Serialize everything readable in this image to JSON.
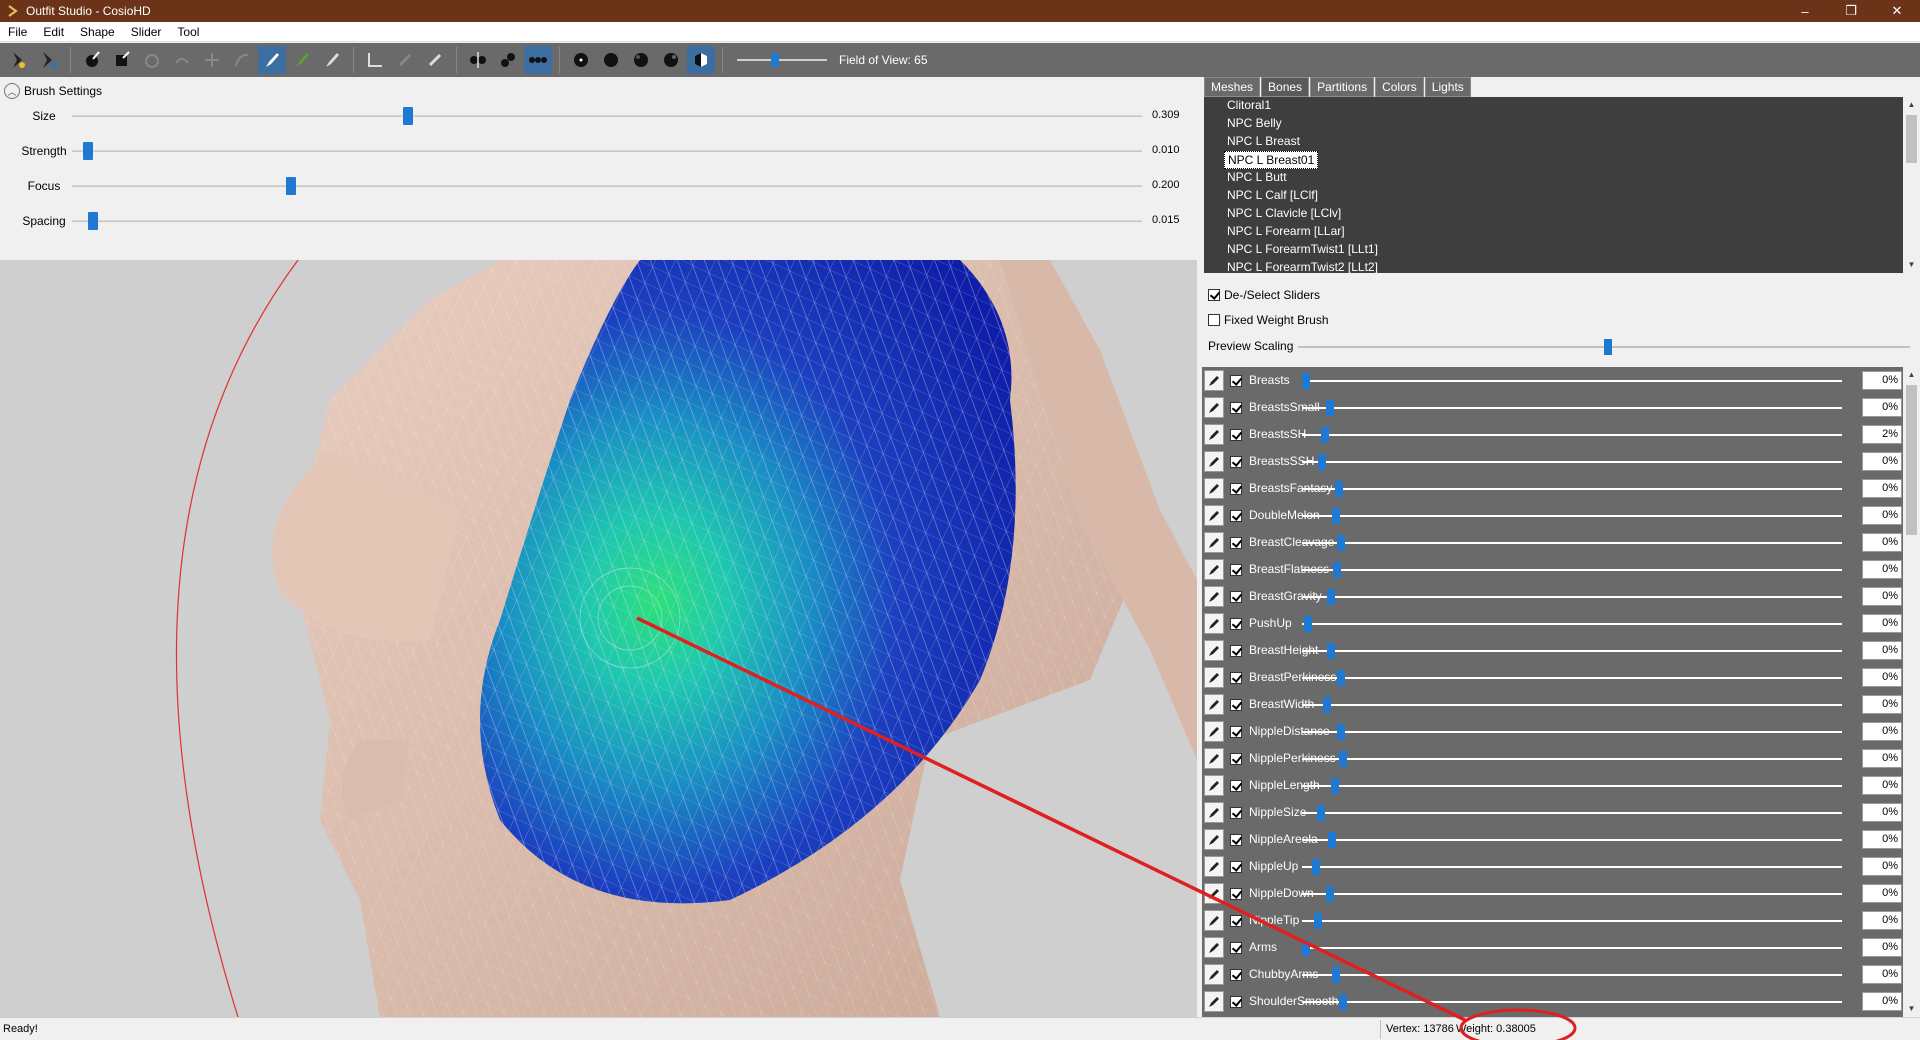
{
  "window": {
    "title": "Outfit Studio - CosioHD",
    "buttons": [
      "–",
      "❐",
      "✕"
    ]
  },
  "menu": [
    "File",
    "Edit",
    "Shape",
    "Slider",
    "Tool"
  ],
  "toolbar": {
    "fov_label": "Field of View: 65",
    "fov_value": 0.38
  },
  "brush_settings": {
    "header": "Brush Settings",
    "rows": [
      {
        "label": "Size",
        "value": "0.309",
        "fraction": 0.309
      },
      {
        "label": "Strength",
        "value": "0.010",
        "fraction": 0.01
      },
      {
        "label": "Focus",
        "value": "0.200",
        "fraction": 0.2
      },
      {
        "label": "Spacing",
        "value": "0.015",
        "fraction": 0.015
      }
    ]
  },
  "right_panel": {
    "tabs": [
      "Meshes",
      "Bones",
      "Partitions",
      "Colors",
      "Lights"
    ],
    "active_tab": "Bones",
    "bones": [
      "Clitoral1",
      "NPC Belly",
      "NPC L Breast",
      "NPC L Breast01",
      "NPC L Butt",
      "NPC L Calf [LClf]",
      "NPC L Clavicle [LClv]",
      "NPC L Forearm [LLar]",
      "NPC L ForearmTwist1 [LLt1]",
      "NPC L ForearmTwist2 [LLt2]"
    ],
    "selected_bone": "NPC L Breast01",
    "deselect_sliders": {
      "label": "De-/Select Sliders",
      "checked": true
    },
    "fixed_weight_brush": {
      "label": "Fixed Weight Brush",
      "checked": false
    },
    "preview_scaling": {
      "label": "Preview Scaling",
      "value": 0.5
    }
  },
  "sliders": [
    {
      "name": "Breasts",
      "pct": "0%",
      "pos": 0.0
    },
    {
      "name": "BreastsSmall",
      "pct": "0%",
      "pos": 0.045
    },
    {
      "name": "BreastsSH",
      "pct": "2%",
      "pos": 0.036
    },
    {
      "name": "BreastsSSH",
      "pct": "0%",
      "pos": 0.03
    },
    {
      "name": "BreastsFantasy",
      "pct": "0%",
      "pos": 0.062
    },
    {
      "name": "DoubleMelon",
      "pct": "0%",
      "pos": 0.055
    },
    {
      "name": "BreastCleavage",
      "pct": "0%",
      "pos": 0.065
    },
    {
      "name": "BreastFlatness",
      "pct": "0%",
      "pos": 0.058
    },
    {
      "name": "BreastGravity",
      "pct": "0%",
      "pos": 0.047
    },
    {
      "name": "PushUp",
      "pct": "0%",
      "pos": 0.004
    },
    {
      "name": "BreastHeight",
      "pct": "0%",
      "pos": 0.047
    },
    {
      "name": "BreastPerkiness",
      "pct": "0%",
      "pos": 0.065
    },
    {
      "name": "BreastWidth",
      "pct": "0%",
      "pos": 0.038
    },
    {
      "name": "NippleDistance",
      "pct": "0%",
      "pos": 0.065
    },
    {
      "name": "NipplePerkiness",
      "pct": "0%",
      "pos": 0.069
    },
    {
      "name": "NippleLength",
      "pct": "0%",
      "pos": 0.053
    },
    {
      "name": "NippleSize",
      "pct": "0%",
      "pos": 0.028
    },
    {
      "name": "NippleAreola",
      "pct": "0%",
      "pos": 0.049
    },
    {
      "name": "NippleUp",
      "pct": "0%",
      "pos": 0.018
    },
    {
      "name": "NippleDown",
      "pct": "0%",
      "pos": 0.045
    },
    {
      "name": "NippleTip",
      "pct": "0%",
      "pos": 0.022
    },
    {
      "name": "Arms",
      "pct": "0%",
      "pos": 0.0
    },
    {
      "name": "ChubbyArms",
      "pct": "0%",
      "pos": 0.055
    },
    {
      "name": "ShoulderSmooth",
      "pct": "0%",
      "pos": 0.069
    }
  ],
  "status": {
    "text": "Ready!",
    "vertex": "Vertex: 13786",
    "weight": "Weight: 0.38005"
  },
  "colors": {
    "titlebar": "#6b3418",
    "toolbar": "#6a6a6a",
    "accent": "#1f78d1",
    "annotation": "#e02020"
  }
}
